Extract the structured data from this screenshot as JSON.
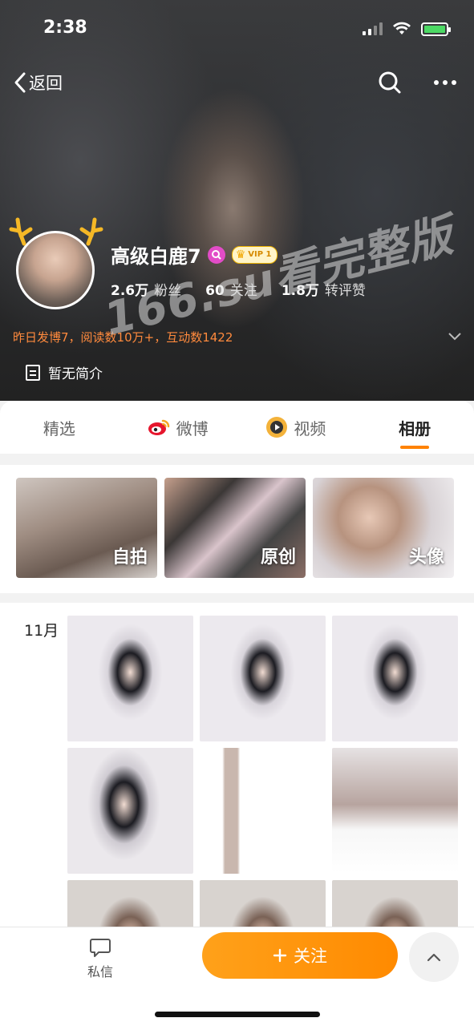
{
  "status": {
    "time": "2:38"
  },
  "nav": {
    "back_label": "返回"
  },
  "profile": {
    "name": "高级白鹿7",
    "vip_label": "VIP 1",
    "stats": [
      {
        "num": "2.6万",
        "label": "粉丝"
      },
      {
        "num": "60",
        "label": "关注"
      },
      {
        "num": "1.8万",
        "label": "转评赞"
      }
    ],
    "promo": "昨日发博7，阅读数10万+，互动数1422",
    "intro": "暂无简介"
  },
  "watermark": "166.su看完整版",
  "tabs": [
    "精选",
    "微博",
    "视频",
    "相册"
  ],
  "active_tab": "相册",
  "albums": [
    "自拍",
    "原创",
    "头像"
  ],
  "photos": {
    "month": "11月"
  },
  "bottom": {
    "pm_label": "私信",
    "follow_label": "关注"
  },
  "colors": {
    "accent": "#ff8200",
    "promo": "#ff8a3d",
    "battery": "#4cd964"
  },
  "icons": [
    "back-chevron-icon",
    "search-icon",
    "more-icon",
    "weibo-icon",
    "video-icon",
    "document-icon",
    "message-icon",
    "plus-icon",
    "chevron-up-icon"
  ]
}
